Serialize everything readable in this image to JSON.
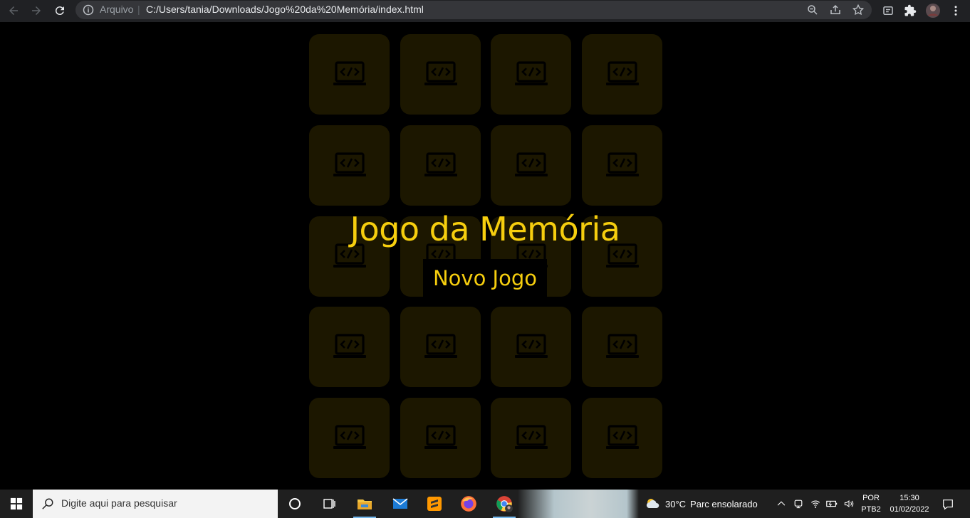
{
  "browser": {
    "scheme_label": "Arquivo",
    "separator": "|",
    "url": "C:/Users/tania/Downloads/Jogo%20da%20Memória/index.html",
    "icons": [
      "back-icon",
      "forward-icon",
      "reload-icon",
      "info-icon",
      "zoom-icon",
      "share-icon",
      "star-icon",
      "reading-list-icon",
      "extensions-icon",
      "profile-avatar",
      "menu-icon"
    ]
  },
  "game": {
    "title": "Jogo da Memória",
    "new_game_label": "Novo Jogo",
    "card_back_icon": "laptop-code-icon",
    "rows": 5,
    "cols": 4,
    "colors": {
      "accent": "#f6ce0e",
      "card_back": "#1c1700",
      "background": "#000000"
    }
  },
  "taskbar": {
    "search_placeholder": "Digite aqui para pesquisar",
    "apps": [
      "cortana-icon",
      "task-view-icon",
      "file-explorer-icon",
      "mail-icon",
      "sublime-text-icon",
      "firefox-icon",
      "chrome-icon"
    ],
    "weather_temp": "30°C",
    "weather_desc": "Parc ensolarado",
    "lang_top": "POR",
    "lang_bottom": "PTB2",
    "time": "15:30",
    "date": "01/02/2022"
  }
}
